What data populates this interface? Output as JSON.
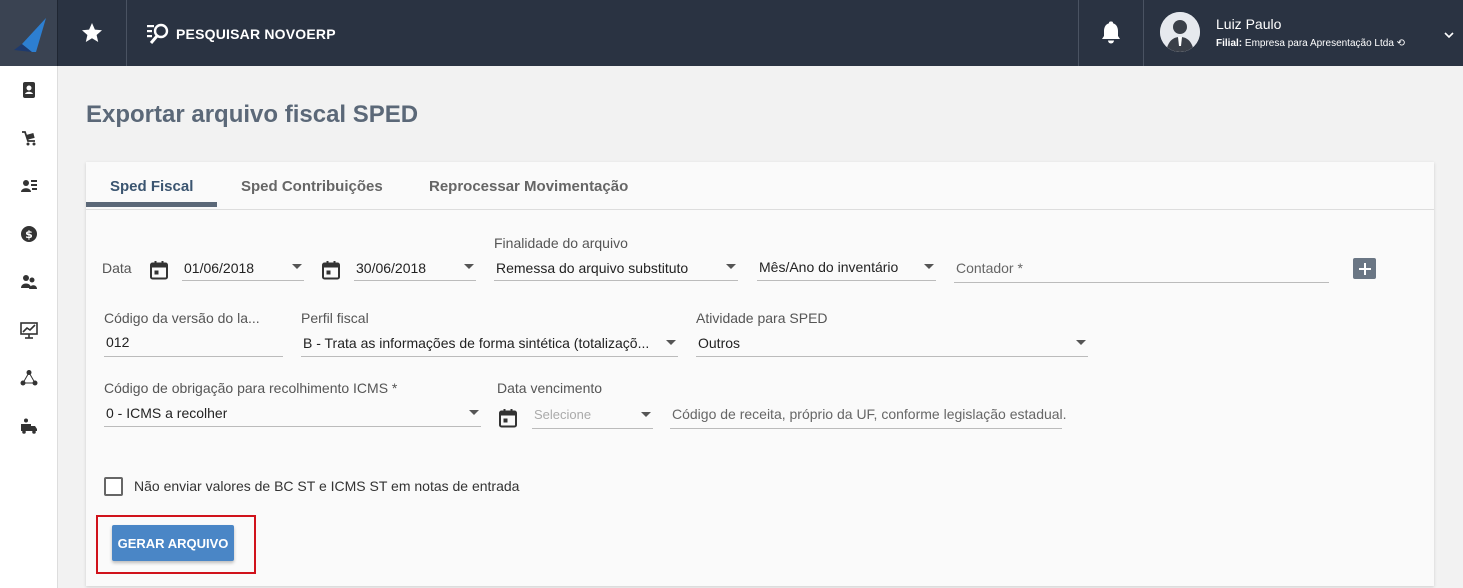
{
  "topbar": {
    "search_label": "PESQUISAR NOVOERP",
    "user": {
      "name": "Luiz Paulo",
      "branch_label": "Filial:",
      "branch_value": "Empresa para Apresentação Ltda"
    }
  },
  "sidebar": {
    "items": [
      {
        "icon": "contacts-icon"
      },
      {
        "icon": "cart-icon"
      },
      {
        "icon": "users-icon"
      },
      {
        "icon": "dollar-icon"
      },
      {
        "icon": "people-icon"
      },
      {
        "icon": "chart-icon"
      },
      {
        "icon": "network-icon"
      },
      {
        "icon": "truck-icon"
      }
    ]
  },
  "page": {
    "title": "Exportar arquivo fiscal SPED"
  },
  "tabs": [
    {
      "label": "Sped Fiscal",
      "active": true
    },
    {
      "label": "Sped Contribuições",
      "active": false
    },
    {
      "label": "Reprocessar Movimentação",
      "active": false
    }
  ],
  "form": {
    "data_label": "Data",
    "date_start": "01/06/2018",
    "date_end": "30/06/2018",
    "finalidade_label": "Finalidade do arquivo",
    "finalidade_value": "Remessa do arquivo substituto",
    "inventario_placeholder": "Mês/Ano do inventário",
    "contador_placeholder": "Contador *",
    "versao_label": "Código da versão do la...",
    "versao_value": "012",
    "perfil_label": "Perfil fiscal",
    "perfil_value": "B - Trata as informações de forma sintética (totalizaçõ...",
    "atividade_label": "Atividade para SPED",
    "atividade_value": "Outros",
    "obrigacao_label": "Código de obrigação para recolhimento ICMS *",
    "obrigacao_value": "0 - ICMS a recolher",
    "vencimento_label": "Data vencimento",
    "vencimento_placeholder": "Selecione",
    "receita_placeholder": "Código de receita, próprio da UF, conforme legislação estadual.",
    "checkbox_label": "Não enviar valores de BC ST e ICMS ST em notas de entrada",
    "generate_button": "GERAR ARQUIVO"
  },
  "colors": {
    "topbar": "#2a3342",
    "accent_button": "#4a86c6",
    "highlight": "#d0121b",
    "title": "#5b6878"
  }
}
